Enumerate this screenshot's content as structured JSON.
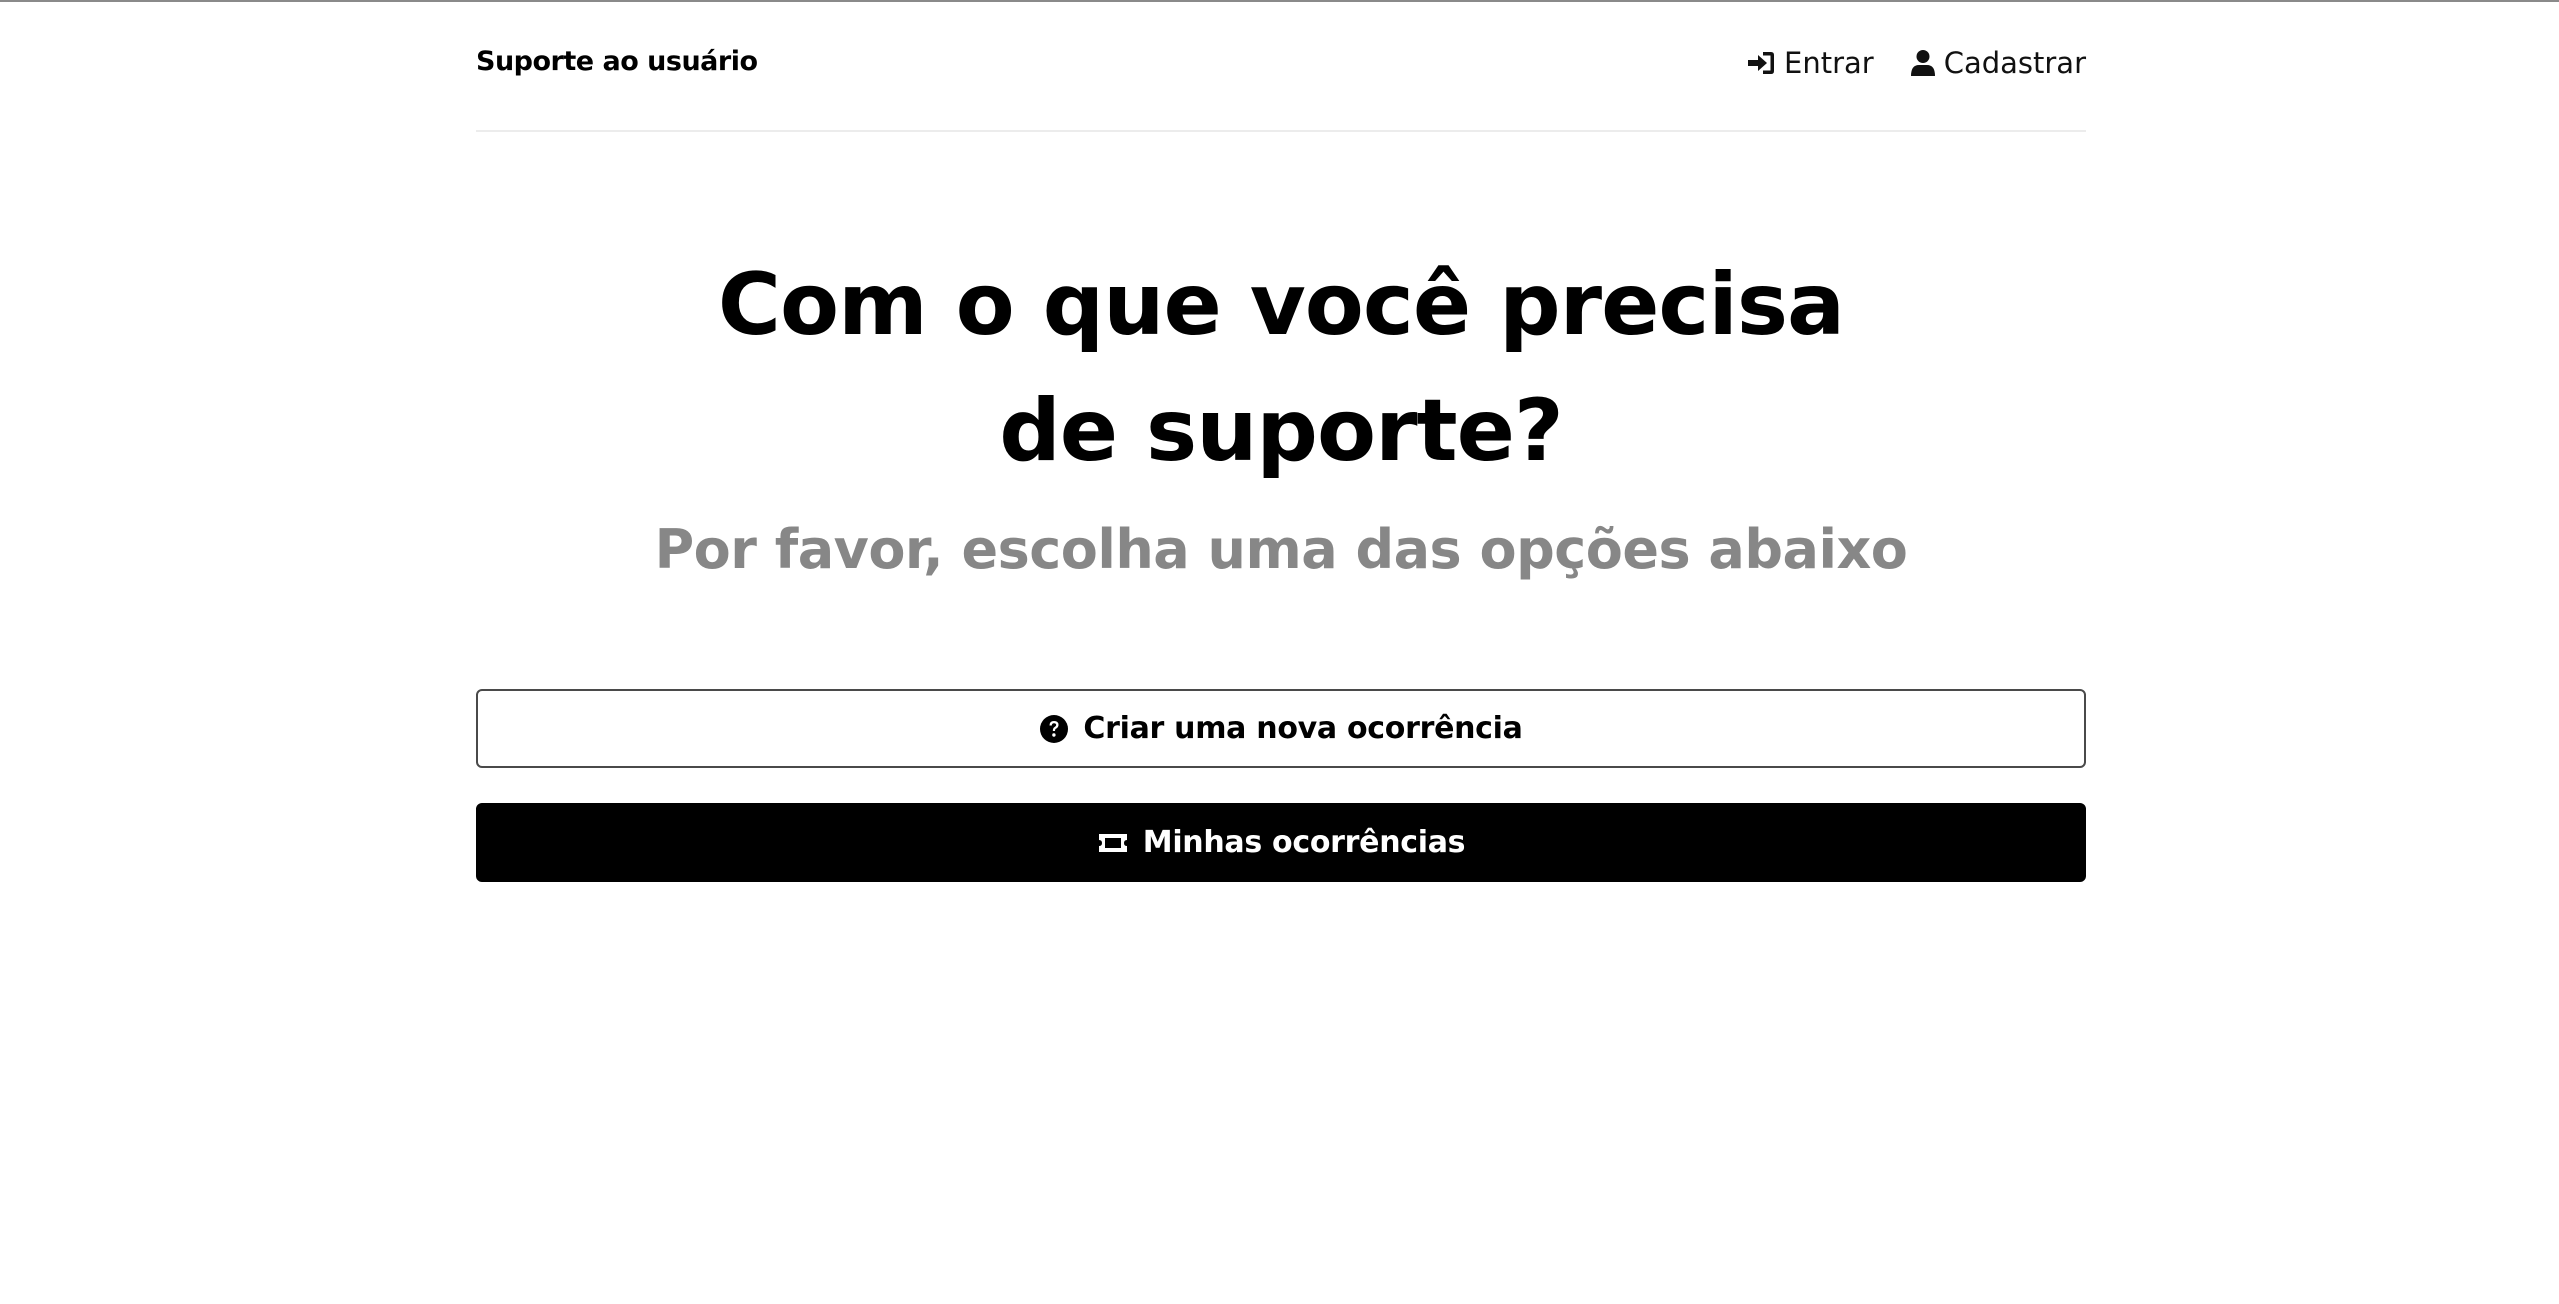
{
  "header": {
    "brand": "Suporte ao usuário",
    "nav": [
      {
        "label": "Entrar",
        "icon": "sign-in-icon"
      },
      {
        "label": "Cadastrar",
        "icon": "user-icon"
      }
    ]
  },
  "hero": {
    "title": "Com o que você precisa de suporte?",
    "subtitle": "Por favor, escolha uma das opções abaixo"
  },
  "actions": {
    "new_ticket": {
      "label": "Criar uma nova ocorrência",
      "icon": "question-circle-icon"
    },
    "my_tickets": {
      "label": "Minhas ocorrências",
      "icon": "ticket-icon"
    }
  },
  "colors": {
    "primary": "#000000",
    "subtitle": "#878787",
    "background": "#ffffff",
    "divider": "#ececec"
  }
}
